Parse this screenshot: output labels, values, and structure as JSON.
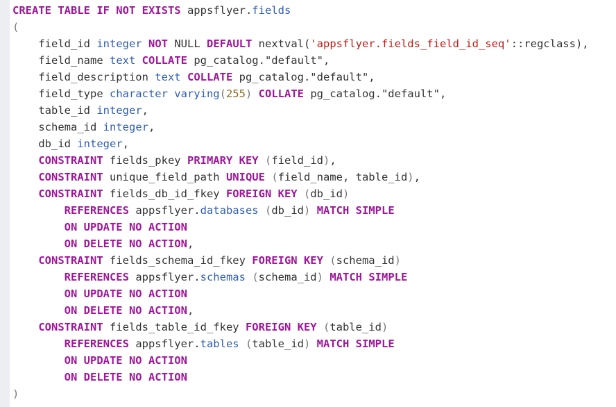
{
  "colors": {
    "keyword": "#a0169b",
    "type": "#2f5db5",
    "string": "#c41a16",
    "number": "#8b6a1e",
    "punctuation": "#777777",
    "default": "#333333",
    "gutter": "#eceef1"
  },
  "lines": [
    [
      [
        "k",
        "CREATE TABLE IF NOT EXISTS"
      ],
      [
        "d",
        " appsflyer."
      ],
      [
        "t",
        "fields"
      ]
    ],
    [
      [
        "p",
        "("
      ]
    ],
    [
      [
        "d",
        "    field_id "
      ],
      [
        "t",
        "integer"
      ],
      [
        "d",
        " "
      ],
      [
        "k",
        "NOT"
      ],
      [
        "d",
        " NULL "
      ],
      [
        "k",
        "DEFAULT"
      ],
      [
        "d",
        " nextval("
      ],
      [
        "s",
        "'appsflyer.fields_field_id_seq'"
      ],
      [
        "d",
        "::regclass),"
      ]
    ],
    [
      [
        "d",
        "    field_name "
      ],
      [
        "t",
        "text"
      ],
      [
        "d",
        " "
      ],
      [
        "k",
        "COLLATE"
      ],
      [
        "d",
        " pg_catalog.\"default\","
      ]
    ],
    [
      [
        "d",
        "    field_description "
      ],
      [
        "t",
        "text"
      ],
      [
        "d",
        " "
      ],
      [
        "k",
        "COLLATE"
      ],
      [
        "d",
        " pg_catalog.\"default\","
      ]
    ],
    [
      [
        "d",
        "    field_type "
      ],
      [
        "t",
        "character varying"
      ],
      [
        "p",
        "("
      ],
      [
        "n",
        "255"
      ],
      [
        "p",
        ")"
      ],
      [
        "d",
        " "
      ],
      [
        "k",
        "COLLATE"
      ],
      [
        "d",
        " pg_catalog.\"default\","
      ]
    ],
    [
      [
        "d",
        "    table_id "
      ],
      [
        "t",
        "integer"
      ],
      [
        "d",
        ","
      ]
    ],
    [
      [
        "d",
        "    schema_id "
      ],
      [
        "t",
        "integer"
      ],
      [
        "d",
        ","
      ]
    ],
    [
      [
        "d",
        "    db_id "
      ],
      [
        "t",
        "integer"
      ],
      [
        "d",
        ","
      ]
    ],
    [
      [
        "d",
        "    "
      ],
      [
        "k",
        "CONSTRAINT"
      ],
      [
        "d",
        " fields_pkey "
      ],
      [
        "k",
        "PRIMARY KEY"
      ],
      [
        "d",
        " "
      ],
      [
        "p",
        "("
      ],
      [
        "d",
        "field_id"
      ],
      [
        "p",
        ")"
      ],
      [
        "d",
        ","
      ]
    ],
    [
      [
        "d",
        "    "
      ],
      [
        "k",
        "CONSTRAINT"
      ],
      [
        "d",
        " unique_field_path "
      ],
      [
        "k",
        "UNIQUE"
      ],
      [
        "d",
        " "
      ],
      [
        "p",
        "("
      ],
      [
        "d",
        "field_name, table_id"
      ],
      [
        "p",
        ")"
      ],
      [
        "d",
        ","
      ]
    ],
    [
      [
        "d",
        "    "
      ],
      [
        "k",
        "CONSTRAINT"
      ],
      [
        "d",
        " fields_db_id_fkey "
      ],
      [
        "k",
        "FOREIGN KEY"
      ],
      [
        "d",
        " "
      ],
      [
        "p",
        "("
      ],
      [
        "d",
        "db_id"
      ],
      [
        "p",
        ")"
      ]
    ],
    [
      [
        "d",
        "        "
      ],
      [
        "k",
        "REFERENCES"
      ],
      [
        "d",
        " appsflyer."
      ],
      [
        "t",
        "databases"
      ],
      [
        "d",
        " "
      ],
      [
        "p",
        "("
      ],
      [
        "d",
        "db_id"
      ],
      [
        "p",
        ")"
      ],
      [
        "d",
        " "
      ],
      [
        "k",
        "MATCH SIMPLE"
      ]
    ],
    [
      [
        "d",
        "        "
      ],
      [
        "k",
        "ON UPDATE NO ACTION"
      ]
    ],
    [
      [
        "d",
        "        "
      ],
      [
        "k",
        "ON DELETE NO ACTION"
      ],
      [
        "d",
        ","
      ]
    ],
    [
      [
        "d",
        "    "
      ],
      [
        "k",
        "CONSTRAINT"
      ],
      [
        "d",
        " fields_schema_id_fkey "
      ],
      [
        "k",
        "FOREIGN KEY"
      ],
      [
        "d",
        " "
      ],
      [
        "p",
        "("
      ],
      [
        "d",
        "schema_id"
      ],
      [
        "p",
        ")"
      ]
    ],
    [
      [
        "d",
        "        "
      ],
      [
        "k",
        "REFERENCES"
      ],
      [
        "d",
        " appsflyer."
      ],
      [
        "t",
        "schemas"
      ],
      [
        "d",
        " "
      ],
      [
        "p",
        "("
      ],
      [
        "d",
        "schema_id"
      ],
      [
        "p",
        ")"
      ],
      [
        "d",
        " "
      ],
      [
        "k",
        "MATCH SIMPLE"
      ]
    ],
    [
      [
        "d",
        "        "
      ],
      [
        "k",
        "ON UPDATE NO ACTION"
      ]
    ],
    [
      [
        "d",
        "        "
      ],
      [
        "k",
        "ON DELETE NO ACTION"
      ],
      [
        "d",
        ","
      ]
    ],
    [
      [
        "d",
        "    "
      ],
      [
        "k",
        "CONSTRAINT"
      ],
      [
        "d",
        " fields_table_id_fkey "
      ],
      [
        "k",
        "FOREIGN KEY"
      ],
      [
        "d",
        " "
      ],
      [
        "p",
        "("
      ],
      [
        "d",
        "table_id"
      ],
      [
        "p",
        ")"
      ]
    ],
    [
      [
        "d",
        "        "
      ],
      [
        "k",
        "REFERENCES"
      ],
      [
        "d",
        " appsflyer."
      ],
      [
        "t",
        "tables"
      ],
      [
        "d",
        " "
      ],
      [
        "p",
        "("
      ],
      [
        "d",
        "table_id"
      ],
      [
        "p",
        ")"
      ],
      [
        "d",
        " "
      ],
      [
        "k",
        "MATCH SIMPLE"
      ]
    ],
    [
      [
        "d",
        "        "
      ],
      [
        "k",
        "ON UPDATE NO ACTION"
      ]
    ],
    [
      [
        "d",
        "        "
      ],
      [
        "k",
        "ON DELETE NO ACTION"
      ]
    ],
    [
      [
        "p",
        ")"
      ]
    ]
  ]
}
